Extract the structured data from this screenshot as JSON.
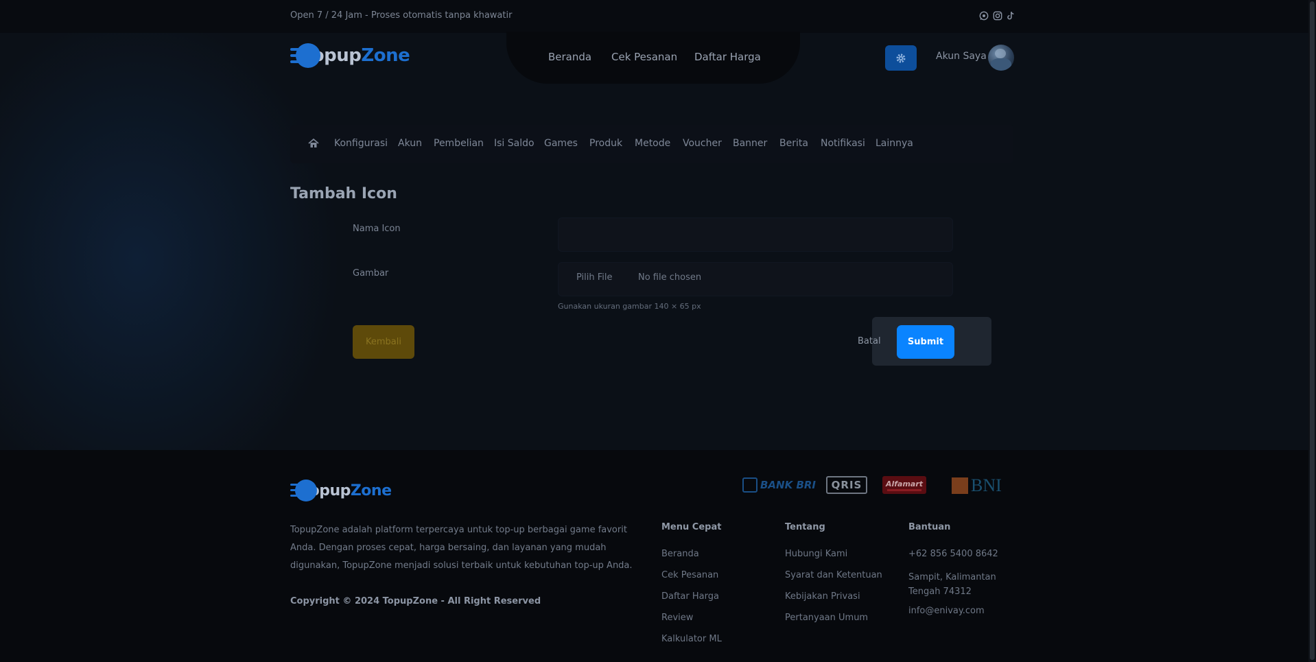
{
  "topbar": {
    "text": "Open 7 / 24 Jam - Proses otomatis tanpa khawatir",
    "icons": [
      "whatsapp-icon",
      "instagram-icon",
      "tiktok-icon"
    ]
  },
  "brand": {
    "part1": "Topup",
    "part2": "Zone"
  },
  "nav": {
    "items": [
      "Beranda",
      "Cek Pesanan",
      "Daftar Harga"
    ]
  },
  "account": {
    "label": "Akun Saya"
  },
  "admin_menu": {
    "items": [
      "Konfigurasi",
      "Akun",
      "Pembelian",
      "Isi Saldo",
      "Games",
      "Produk",
      "Metode",
      "Voucher",
      "Banner",
      "Berita",
      "Notifikasi",
      "Lainnya"
    ]
  },
  "form": {
    "title": "Tambah Icon",
    "name_label": "Nama Icon",
    "name_value": "",
    "image_label": "Gambar",
    "file_button": "Pilih File",
    "file_status": "No file chosen",
    "hint": "Gunakan ukuran gambar 140 × 65 px",
    "back_label": "Kembali",
    "cancel_label": "Batal",
    "submit_label": "Submit"
  },
  "footer": {
    "payments": [
      "BANK BRI",
      "QRIS",
      "Alfamart",
      "BNI"
    ],
    "description": "TopupZone adalah platform terpercaya untuk top-up berbagai game favorit Anda. Dengan proses cepat, harga bersaing, dan layanan yang mudah digunakan, TopupZone menjadi solusi terbaik untuk kebutuhan top-up Anda.",
    "copyright": "Copyright © 2024 TopupZone - All Right Reserved",
    "menu_title": "Menu Cepat",
    "menu_links": [
      "Beranda",
      "Cek Pesanan",
      "Daftar Harga",
      "Review",
      "Kalkulator ML"
    ],
    "about_title": "Tentang",
    "about_links": [
      "Hubungi Kami",
      "Syarat dan Ketentuan",
      "Kebijakan Privasi",
      "Pertanyaan Umum"
    ],
    "help_title": "Bantuan",
    "phone": "+62 856 5400 8642",
    "address": "Sampit, Kalimantan Tengah 74312",
    "email": "info@enivay.com"
  },
  "colors": {
    "accent": "#0a84ff",
    "back_button": "#5e4a0a",
    "background": "#0b0f16"
  }
}
